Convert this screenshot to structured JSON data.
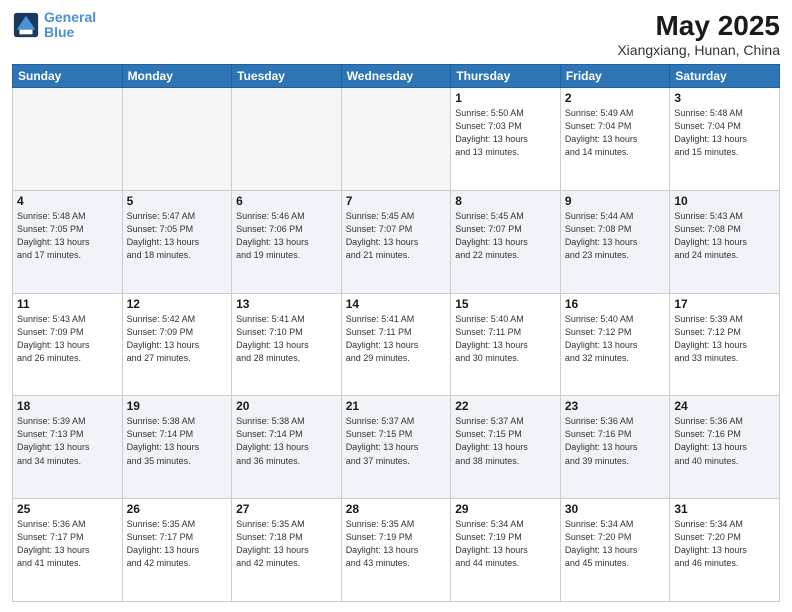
{
  "header": {
    "logo_line1": "General",
    "logo_line2": "Blue",
    "month": "May 2025",
    "location": "Xiangxiang, Hunan, China"
  },
  "weekdays": [
    "Sunday",
    "Monday",
    "Tuesday",
    "Wednesday",
    "Thursday",
    "Friday",
    "Saturday"
  ],
  "weeks": [
    [
      {
        "day": "",
        "info": ""
      },
      {
        "day": "",
        "info": ""
      },
      {
        "day": "",
        "info": ""
      },
      {
        "day": "",
        "info": ""
      },
      {
        "day": "1",
        "info": "Sunrise: 5:50 AM\nSunset: 7:03 PM\nDaylight: 13 hours\nand 13 minutes."
      },
      {
        "day": "2",
        "info": "Sunrise: 5:49 AM\nSunset: 7:04 PM\nDaylight: 13 hours\nand 14 minutes."
      },
      {
        "day": "3",
        "info": "Sunrise: 5:48 AM\nSunset: 7:04 PM\nDaylight: 13 hours\nand 15 minutes."
      }
    ],
    [
      {
        "day": "4",
        "info": "Sunrise: 5:48 AM\nSunset: 7:05 PM\nDaylight: 13 hours\nand 17 minutes."
      },
      {
        "day": "5",
        "info": "Sunrise: 5:47 AM\nSunset: 7:05 PM\nDaylight: 13 hours\nand 18 minutes."
      },
      {
        "day": "6",
        "info": "Sunrise: 5:46 AM\nSunset: 7:06 PM\nDaylight: 13 hours\nand 19 minutes."
      },
      {
        "day": "7",
        "info": "Sunrise: 5:45 AM\nSunset: 7:07 PM\nDaylight: 13 hours\nand 21 minutes."
      },
      {
        "day": "8",
        "info": "Sunrise: 5:45 AM\nSunset: 7:07 PM\nDaylight: 13 hours\nand 22 minutes."
      },
      {
        "day": "9",
        "info": "Sunrise: 5:44 AM\nSunset: 7:08 PM\nDaylight: 13 hours\nand 23 minutes."
      },
      {
        "day": "10",
        "info": "Sunrise: 5:43 AM\nSunset: 7:08 PM\nDaylight: 13 hours\nand 24 minutes."
      }
    ],
    [
      {
        "day": "11",
        "info": "Sunrise: 5:43 AM\nSunset: 7:09 PM\nDaylight: 13 hours\nand 26 minutes."
      },
      {
        "day": "12",
        "info": "Sunrise: 5:42 AM\nSunset: 7:09 PM\nDaylight: 13 hours\nand 27 minutes."
      },
      {
        "day": "13",
        "info": "Sunrise: 5:41 AM\nSunset: 7:10 PM\nDaylight: 13 hours\nand 28 minutes."
      },
      {
        "day": "14",
        "info": "Sunrise: 5:41 AM\nSunset: 7:11 PM\nDaylight: 13 hours\nand 29 minutes."
      },
      {
        "day": "15",
        "info": "Sunrise: 5:40 AM\nSunset: 7:11 PM\nDaylight: 13 hours\nand 30 minutes."
      },
      {
        "day": "16",
        "info": "Sunrise: 5:40 AM\nSunset: 7:12 PM\nDaylight: 13 hours\nand 32 minutes."
      },
      {
        "day": "17",
        "info": "Sunrise: 5:39 AM\nSunset: 7:12 PM\nDaylight: 13 hours\nand 33 minutes."
      }
    ],
    [
      {
        "day": "18",
        "info": "Sunrise: 5:39 AM\nSunset: 7:13 PM\nDaylight: 13 hours\nand 34 minutes."
      },
      {
        "day": "19",
        "info": "Sunrise: 5:38 AM\nSunset: 7:14 PM\nDaylight: 13 hours\nand 35 minutes."
      },
      {
        "day": "20",
        "info": "Sunrise: 5:38 AM\nSunset: 7:14 PM\nDaylight: 13 hours\nand 36 minutes."
      },
      {
        "day": "21",
        "info": "Sunrise: 5:37 AM\nSunset: 7:15 PM\nDaylight: 13 hours\nand 37 minutes."
      },
      {
        "day": "22",
        "info": "Sunrise: 5:37 AM\nSunset: 7:15 PM\nDaylight: 13 hours\nand 38 minutes."
      },
      {
        "day": "23",
        "info": "Sunrise: 5:36 AM\nSunset: 7:16 PM\nDaylight: 13 hours\nand 39 minutes."
      },
      {
        "day": "24",
        "info": "Sunrise: 5:36 AM\nSunset: 7:16 PM\nDaylight: 13 hours\nand 40 minutes."
      }
    ],
    [
      {
        "day": "25",
        "info": "Sunrise: 5:36 AM\nSunset: 7:17 PM\nDaylight: 13 hours\nand 41 minutes."
      },
      {
        "day": "26",
        "info": "Sunrise: 5:35 AM\nSunset: 7:17 PM\nDaylight: 13 hours\nand 42 minutes."
      },
      {
        "day": "27",
        "info": "Sunrise: 5:35 AM\nSunset: 7:18 PM\nDaylight: 13 hours\nand 42 minutes."
      },
      {
        "day": "28",
        "info": "Sunrise: 5:35 AM\nSunset: 7:19 PM\nDaylight: 13 hours\nand 43 minutes."
      },
      {
        "day": "29",
        "info": "Sunrise: 5:34 AM\nSunset: 7:19 PM\nDaylight: 13 hours\nand 44 minutes."
      },
      {
        "day": "30",
        "info": "Sunrise: 5:34 AM\nSunset: 7:20 PM\nDaylight: 13 hours\nand 45 minutes."
      },
      {
        "day": "31",
        "info": "Sunrise: 5:34 AM\nSunset: 7:20 PM\nDaylight: 13 hours\nand 46 minutes."
      }
    ]
  ]
}
